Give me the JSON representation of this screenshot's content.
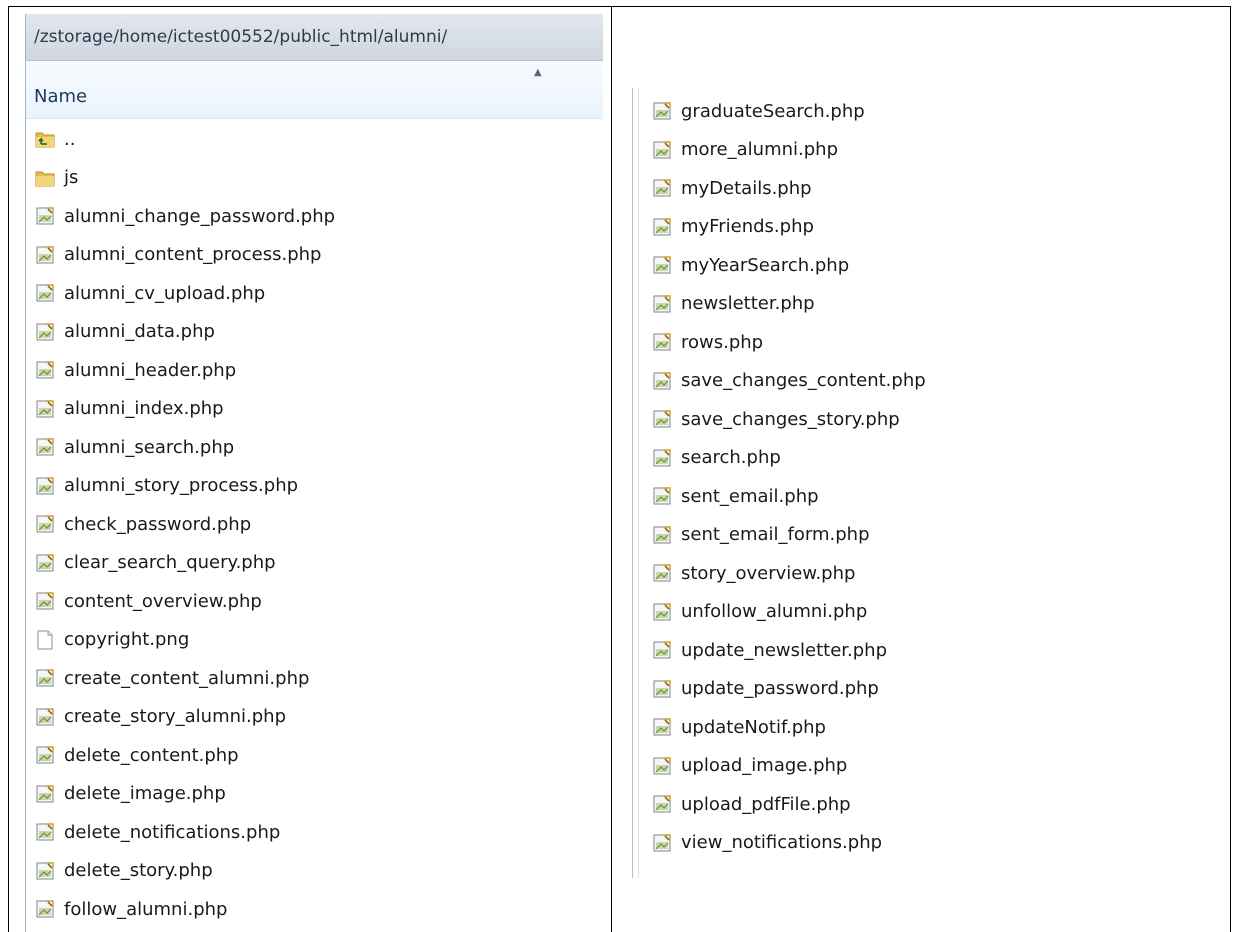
{
  "left_panel": {
    "path": "/zstorage/home/ictest00552/public_html/alumni/",
    "column_header": "Name",
    "items": [
      {
        "label": "..",
        "icon": "folder-up-icon"
      },
      {
        "label": "js",
        "icon": "folder-icon"
      },
      {
        "label": "alumni_change_password.php",
        "icon": "php-file-icon"
      },
      {
        "label": "alumni_content_process.php",
        "icon": "php-file-icon"
      },
      {
        "label": "alumni_cv_upload.php",
        "icon": "php-file-icon"
      },
      {
        "label": "alumni_data.php",
        "icon": "php-file-icon"
      },
      {
        "label": "alumni_header.php",
        "icon": "php-file-icon"
      },
      {
        "label": "alumni_index.php",
        "icon": "php-file-icon"
      },
      {
        "label": "alumni_search.php",
        "icon": "php-file-icon"
      },
      {
        "label": "alumni_story_process.php",
        "icon": "php-file-icon"
      },
      {
        "label": "check_password.php",
        "icon": "php-file-icon"
      },
      {
        "label": "clear_search_query.php",
        "icon": "php-file-icon"
      },
      {
        "label": "content_overview.php",
        "icon": "php-file-icon"
      },
      {
        "label": "copyright.png",
        "icon": "blank-file-icon"
      },
      {
        "label": "create_content_alumni.php",
        "icon": "php-file-icon"
      },
      {
        "label": "create_story_alumni.php",
        "icon": "php-file-icon"
      },
      {
        "label": "delete_content.php",
        "icon": "php-file-icon"
      },
      {
        "label": "delete_image.php",
        "icon": "php-file-icon"
      },
      {
        "label": "delete_notifications.php",
        "icon": "php-file-icon"
      },
      {
        "label": "delete_story.php",
        "icon": "php-file-icon"
      },
      {
        "label": "follow_alumni.php",
        "icon": "php-file-icon"
      }
    ]
  },
  "right_panel": {
    "items": [
      {
        "label": "graduateSearch.php",
        "icon": "php-file-icon"
      },
      {
        "label": "more_alumni.php",
        "icon": "php-file-icon"
      },
      {
        "label": "myDetails.php",
        "icon": "php-file-icon"
      },
      {
        "label": "myFriends.php",
        "icon": "php-file-icon"
      },
      {
        "label": "myYearSearch.php",
        "icon": "php-file-icon"
      },
      {
        "label": "newsletter.php",
        "icon": "php-file-icon"
      },
      {
        "label": "rows.php",
        "icon": "php-file-icon"
      },
      {
        "label": "save_changes_content.php",
        "icon": "php-file-icon"
      },
      {
        "label": "save_changes_story.php",
        "icon": "php-file-icon"
      },
      {
        "label": "search.php",
        "icon": "php-file-icon"
      },
      {
        "label": "sent_email.php",
        "icon": "php-file-icon"
      },
      {
        "label": "sent_email_form.php",
        "icon": "php-file-icon"
      },
      {
        "label": "story_overview.php",
        "icon": "php-file-icon"
      },
      {
        "label": "unfollow_alumni.php",
        "icon": "php-file-icon"
      },
      {
        "label": "update_newsletter.php",
        "icon": "php-file-icon"
      },
      {
        "label": "update_password.php",
        "icon": "php-file-icon"
      },
      {
        "label": "updateNotif.php",
        "icon": "php-file-icon"
      },
      {
        "label": "upload_image.php",
        "icon": "php-file-icon"
      },
      {
        "label": "upload_pdfFile.php",
        "icon": "php-file-icon"
      },
      {
        "label": "view_notifications.php",
        "icon": "php-file-icon"
      }
    ]
  },
  "colors": {
    "path_bar": "#d6dce4",
    "header_bg": "#eaf3fc",
    "folder": "#e8c15a",
    "text": "#1a1a1a"
  }
}
